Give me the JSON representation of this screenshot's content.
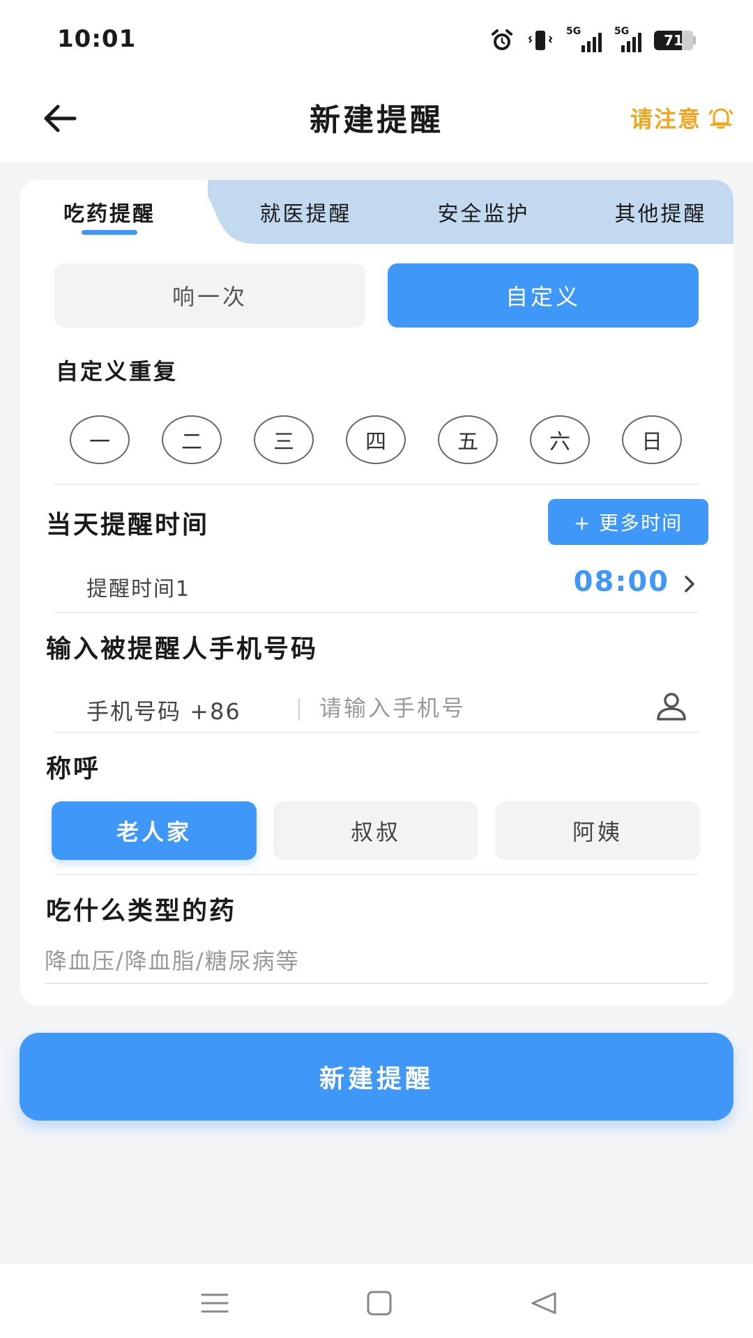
{
  "status_bar": {
    "time": "10:01",
    "net1": "5G",
    "net2": "5G",
    "battery": "71",
    "battery_level": 0.71,
    "icons": [
      "alarm-icon",
      "vibrate-icon",
      "signal-icon",
      "signal-icon",
      "battery-icon"
    ]
  },
  "header": {
    "back_icon": "arrow-left-icon",
    "title": "新建提醒",
    "notice_label": "请注意",
    "notice_icon": "bell-icon"
  },
  "tabs": [
    {
      "label": "吃药提醒",
      "active": true
    },
    {
      "label": "就医提醒",
      "active": false
    },
    {
      "label": "安全监护",
      "active": false
    },
    {
      "label": "其他提醒",
      "active": false
    }
  ],
  "repeat_mode": {
    "once": "响一次",
    "custom": "自定义",
    "selected": "自定义"
  },
  "custom_repeat": {
    "title": "自定义重复",
    "days": [
      "一",
      "二",
      "三",
      "四",
      "五",
      "六",
      "日"
    ]
  },
  "reminder_time": {
    "title": "当天提醒时间",
    "more_button": "+ 更多时间",
    "items": [
      {
        "label": "提醒时间1",
        "time": "08:00"
      }
    ]
  },
  "phone": {
    "title": "输入被提醒人手机号码",
    "prefix": "手机号码 +86",
    "placeholder": "请输入手机号",
    "value": ""
  },
  "address": {
    "title": "称呼",
    "options": [
      "老人家",
      "叔叔",
      "阿姨"
    ],
    "selected": "老人家"
  },
  "medicine": {
    "title": "吃什么类型的药",
    "placeholder": "降血压/降血脂/糖尿病等",
    "value": ""
  },
  "submit_button": "新建提醒",
  "colors": {
    "accent": "#3f97f7",
    "notice": "#f2a41c",
    "tab_bg": "#c3d9ef",
    "page_bg": "#f4f5f7"
  },
  "nav": [
    "menu-icon",
    "home-icon",
    "back-triangle-icon"
  ]
}
